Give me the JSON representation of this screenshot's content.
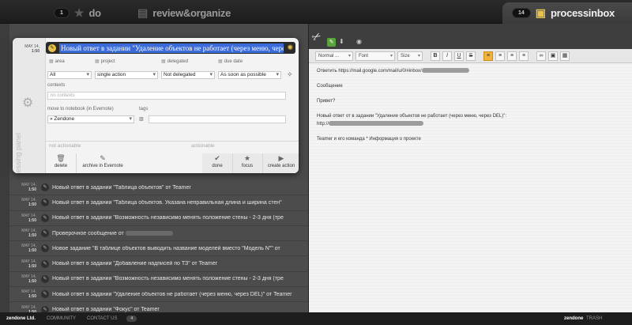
{
  "tabs": {
    "do": {
      "count": "1",
      "label": "do"
    },
    "review": {
      "label": "review&organize"
    },
    "process": {
      "count": "14",
      "label": "processinbox"
    }
  },
  "panel": {
    "date_line1": "MAY 14,",
    "date_line2": "1:50",
    "subject": "Новый ответ в задании \"Удаление объектов не работает (через меню, через DEL",
    "side_label": "processing panel",
    "labels": {
      "area": "area",
      "project": "project",
      "delegated": "delegated",
      "due_date": "due date",
      "contexts": "contexts",
      "notebook": "move to notebook (in Evernote)",
      "tags": "tags"
    },
    "values": {
      "area": "All",
      "project": "single action",
      "delegated": "Not delegated",
      "due_date": "As soon as possible",
      "contexts_placeholder": "no contexts",
      "notebook": "Zendone",
      "tags": ""
    },
    "sections": {
      "not_actionable": "not actionable",
      "actionable": "actionable"
    },
    "actions": {
      "delete": "delete",
      "archive": "archive in Evernote",
      "done": "done",
      "focus": "focus",
      "create_action": "create action"
    }
  },
  "inbox": [
    {
      "d1": "MAY 14,",
      "d2": "1:50",
      "text": "Новый ответ в задании \"Таблица объектов\" от Teamer"
    },
    {
      "d1": "MAY 14,",
      "d2": "1:50",
      "text": "Новый ответ в задании \"Таблица объектов. Указана неправильная длина и ширина стен\""
    },
    {
      "d1": "MAY 14,",
      "d2": "1:50",
      "text": "Новый ответ в задании \"Возможность независимо менять положение стены - 2-3 дня (тре"
    },
    {
      "d1": "MAY 14,",
      "d2": "1:50",
      "text": "Проверочное сообщение от"
    },
    {
      "d1": "MAY 14,",
      "d2": "1:50",
      "text": "Новое задание \"В таблице объектов выводить название моделей вместо \"Модель N\"\" от"
    },
    {
      "d1": "MAY 14,",
      "d2": "1:50",
      "text": "Новый ответ в задании \"Добавление надписей по ТЗ\" от Teamer"
    },
    {
      "d1": "MAY 14,",
      "d2": "1:50",
      "text": "Новый ответ в задании \"Возможность независимо менять положение стены - 2-3 дня (тре"
    },
    {
      "d1": "MAY 14,",
      "d2": "1:50",
      "text": "Новый ответ в задании \"Удаление объектов не работает (через меню, через DEL)\" от Teamer"
    },
    {
      "d1": "MAY 14,",
      "d2": "1:50",
      "text": "Новый ответ в задании \"Фокус\" от Teamer"
    }
  ],
  "editor": {
    "format": "Normal ...",
    "font": "Font",
    "size": "Size",
    "lines": [
      "Ответить https://mail.google.com/mail/u/0/#inbox/",
      "Сообщение",
      "Привет?",
      "Новый ответ от в задании \"Удаление объектов не работает (через меню, через DEL)\":",
      "http://",
      "Teamer и его команда * Информация о проекте"
    ]
  },
  "footer": {
    "brand": "zendone Ltd.",
    "community": "COMMUNITY",
    "contact": "CONTACT US",
    "count": "4",
    "zd": "zendone",
    "trash": "TRASH"
  },
  "colors": {
    "accent": "#e8c24a",
    "selection": "#3b6bd8",
    "evernote": "#5aa43c",
    "active_button": "#f0b43c"
  }
}
